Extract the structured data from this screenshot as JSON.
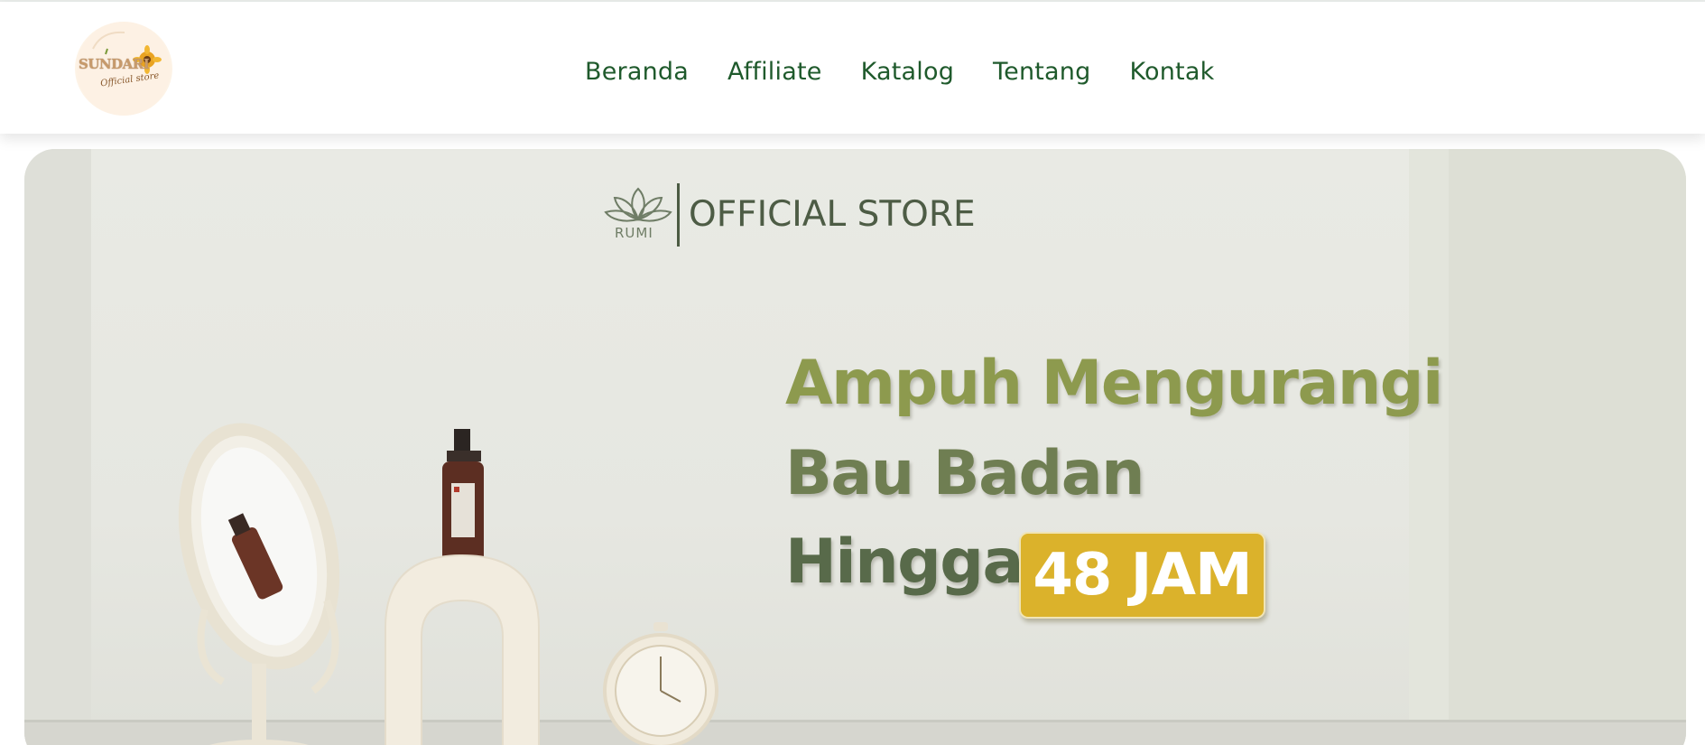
{
  "header": {
    "logo": {
      "brand": "SUNDARI",
      "tagline": "Official store"
    },
    "nav": [
      {
        "label": "Beranda"
      },
      {
        "label": "Affiliate"
      },
      {
        "label": "Katalog"
      },
      {
        "label": "Tentang"
      },
      {
        "label": "Kontak"
      }
    ]
  },
  "hero": {
    "store_logo_text": "RUMI",
    "store_title": "OFFICIAL STORE",
    "headline_line1": "Ampuh Mengurangi",
    "headline_line2": "Bau Badan",
    "headline_line3": "Hingga",
    "badge": "48 JAM"
  },
  "colors": {
    "nav_text": "#1f5a2c",
    "badge_bg": "#dbb22b",
    "hero_bg": "#e9eae4"
  },
  "icons": [
    "sunflower-logo-icon",
    "lotus-logo-icon",
    "mirror-illustration",
    "spray-bottle-illustration",
    "vase-illustration",
    "alarm-clock-illustration"
  ]
}
